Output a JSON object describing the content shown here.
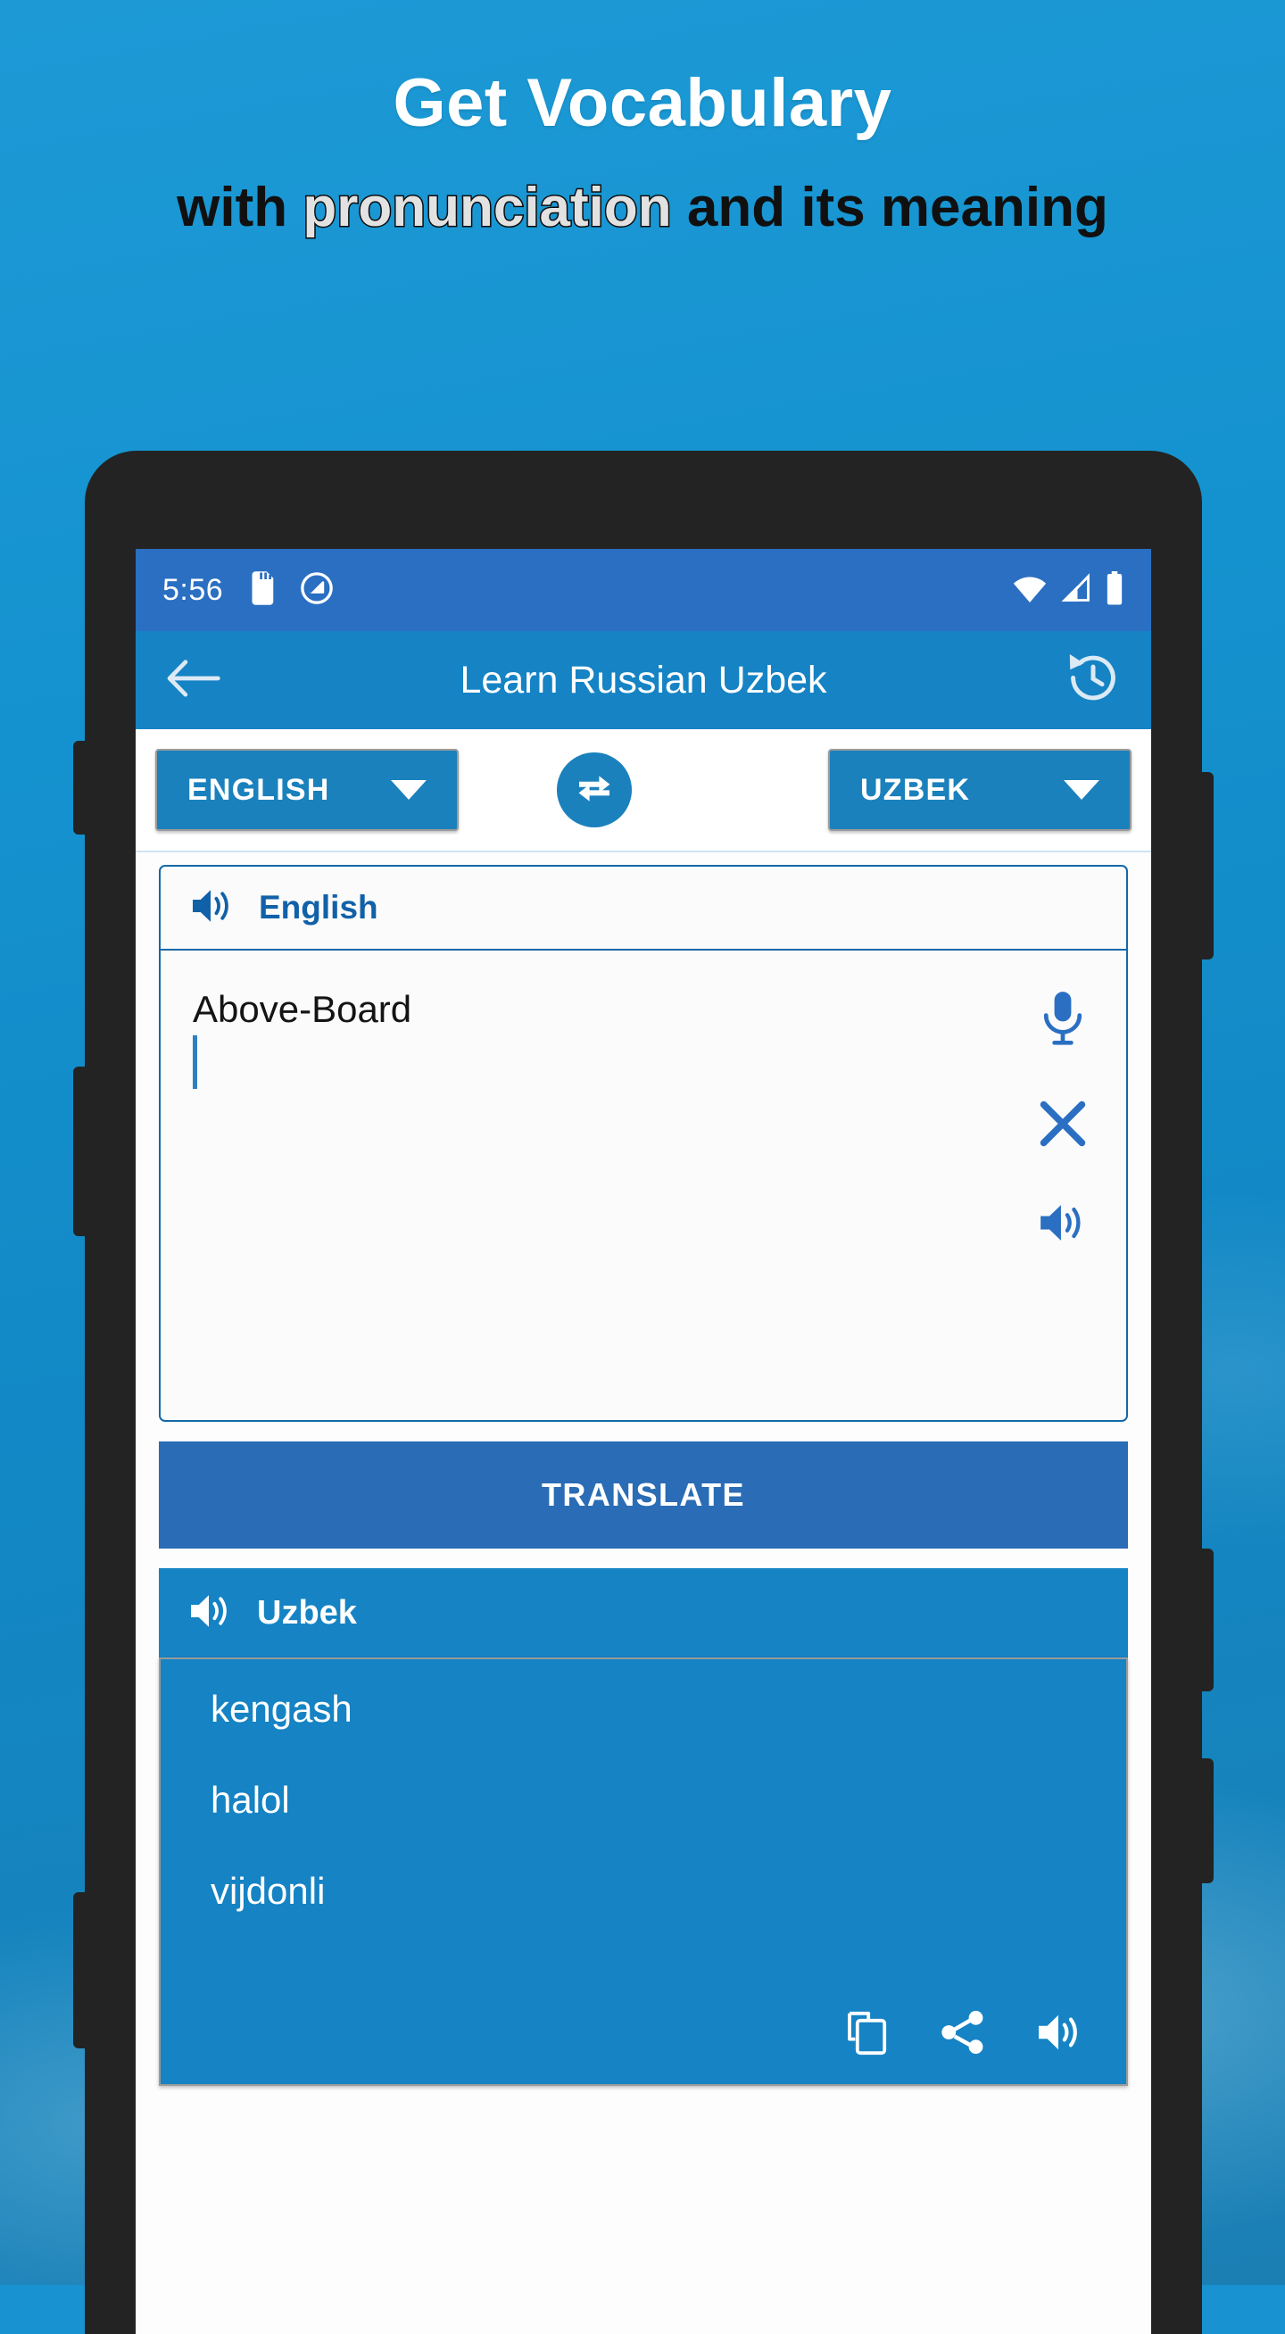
{
  "promo": {
    "title": "Get Vocabulary",
    "subtitle_before": "with ",
    "subtitle_highlight": "pronunciation",
    "subtitle_after": " and its meaning"
  },
  "status_bar": {
    "clock": "5:56",
    "icons": [
      "sd-card-icon",
      "do-not-disturb-icon",
      "wifi-icon",
      "cellular-signal-icon",
      "battery-icon"
    ]
  },
  "app_bar": {
    "title": "Learn Russian Uzbek",
    "back_icon": "back-arrow-icon",
    "history_icon": "history-icon"
  },
  "language_selector": {
    "source_language": "ENGLISH",
    "target_language": "UZBEK",
    "swap_icon": "swap-languages-icon"
  },
  "source_card": {
    "speaker_icon": "speaker-icon",
    "label": "English",
    "text": "Above-Board",
    "actions": [
      "microphone-icon",
      "clear-icon",
      "speaker-icon"
    ]
  },
  "translate_button": {
    "label": "TRANSLATE"
  },
  "result_card": {
    "speaker_icon": "speaker-icon",
    "label": "Uzbek",
    "translations": [
      "kengash",
      "halol",
      "vijdonli"
    ],
    "actions": [
      "copy-icon",
      "share-icon",
      "speaker-icon"
    ]
  },
  "colors": {
    "brand_blue": "#1583c4",
    "status_blue": "#2a6fc2",
    "translate_blue": "#2a6cb5",
    "button_blue": "#1a81bd",
    "label_blue": "#1161a8",
    "bezel": "#232323",
    "background_blue": "#1892d0"
  }
}
